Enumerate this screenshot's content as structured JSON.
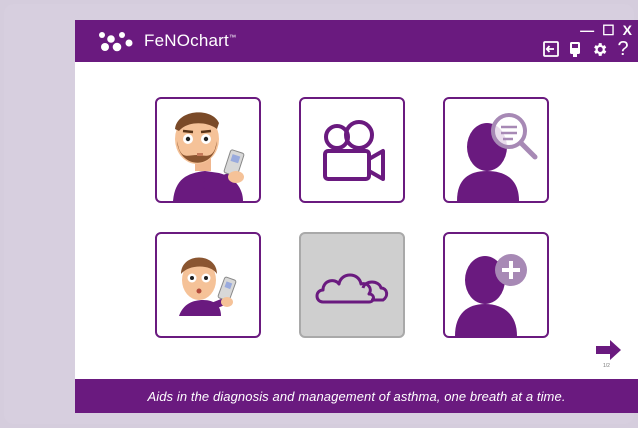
{
  "app": {
    "brand": "FeNOchart",
    "brand_mark": "™"
  },
  "window_controls": [
    {
      "name": "minimize",
      "glyph": "—"
    },
    {
      "name": "maximize",
      "glyph": "☐"
    },
    {
      "name": "close",
      "glyph": "X"
    }
  ],
  "toolbar": [
    {
      "name": "exit-icon"
    },
    {
      "name": "device-icon"
    },
    {
      "name": "settings-icon"
    },
    {
      "name": "help-icon",
      "glyph": "?"
    }
  ],
  "tiles": [
    {
      "name": "adult-measurement-tile",
      "icon": "adult-patient-with-device-icon",
      "enabled": true
    },
    {
      "name": "video-tile",
      "icon": "video-camera-icon",
      "enabled": true
    },
    {
      "name": "search-patient-tile",
      "icon": "patient-search-icon",
      "enabled": true
    },
    {
      "name": "child-measurement-tile",
      "icon": "child-patient-with-device-icon",
      "enabled": true
    },
    {
      "name": "cloud-tile",
      "icon": "cloud-icon",
      "enabled": false
    },
    {
      "name": "add-patient-tile",
      "icon": "add-patient-icon",
      "enabled": true
    }
  ],
  "pagination": {
    "indicator": "1/2",
    "next_icon": "arrow-right-icon"
  },
  "footer": {
    "tagline": "Aids in the diagnosis and management of asthma, one breath at a time."
  },
  "colors": {
    "brand": "#6a1a7f",
    "light": "#a789b5",
    "background": "#d5cddd",
    "disabled": "#cfcfcf"
  }
}
